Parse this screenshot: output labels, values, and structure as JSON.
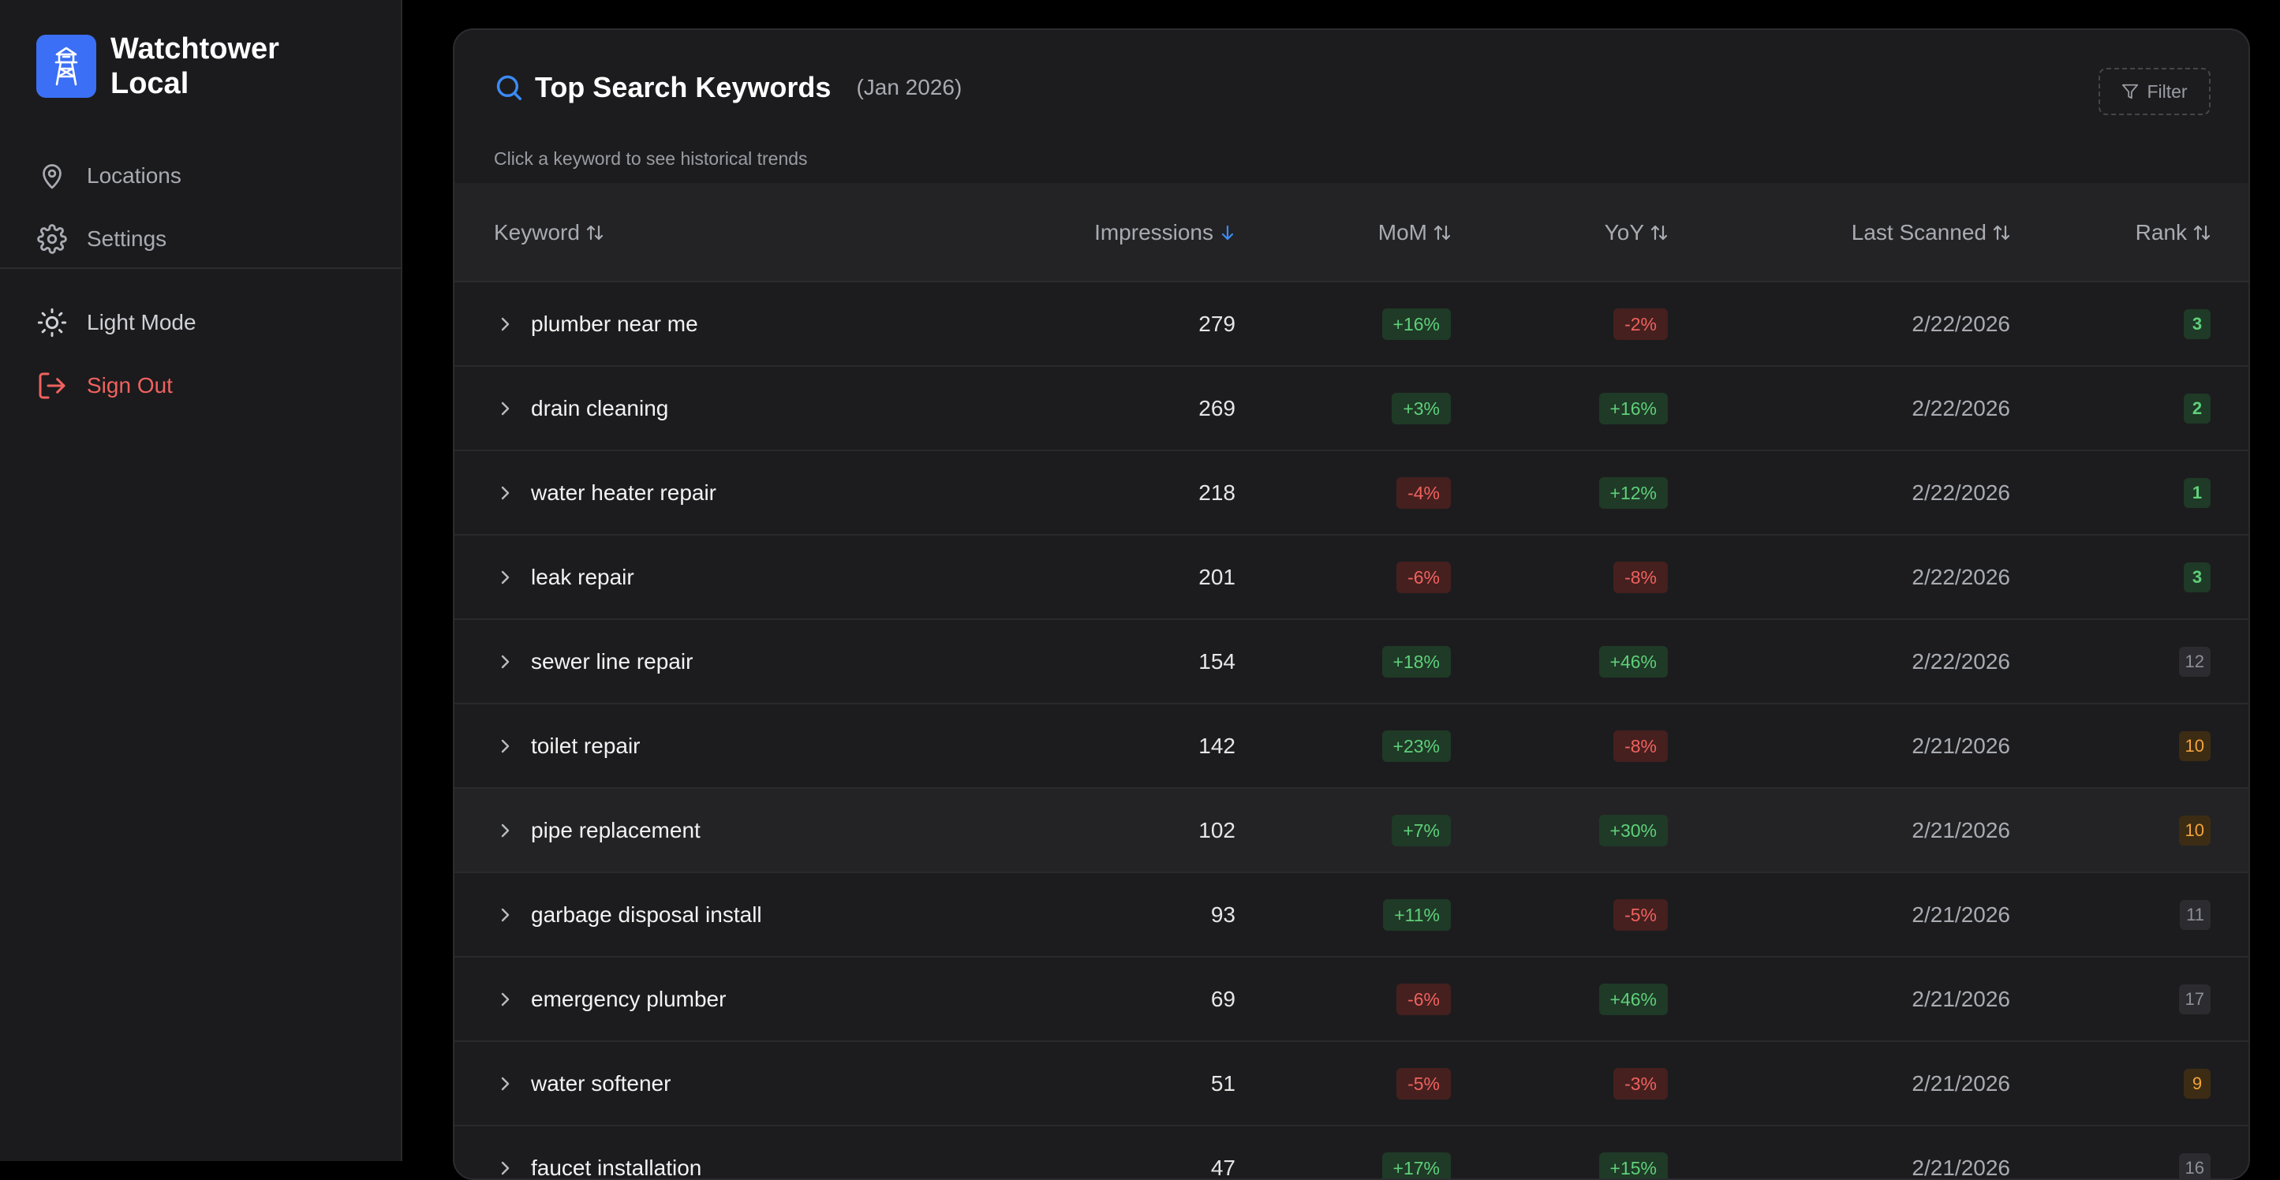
{
  "brand": {
    "name": "Watchtower Local",
    "logo_icon": "watchtower-icon",
    "accent": "#3b6ff5"
  },
  "sidebar": {
    "items": [
      {
        "label": "Locations",
        "icon": "map-pin-icon"
      },
      {
        "label": "Settings",
        "icon": "gear-icon"
      },
      {
        "label": "Light Mode",
        "icon": "sun-icon"
      },
      {
        "label": "Sign Out",
        "icon": "sign-out-icon",
        "color": "#f0625e"
      }
    ]
  },
  "card": {
    "title": "Top Search Keywords",
    "period": "(Jan 2026)",
    "subtitle": "Click a keyword to see historical trends",
    "filter_label": "Filter"
  },
  "table": {
    "columns": [
      {
        "label": "Keyword",
        "sort": "none"
      },
      {
        "label": "Impressions",
        "sort": "desc"
      },
      {
        "label": "MoM",
        "sort": "none"
      },
      {
        "label": "YoY",
        "sort": "none"
      },
      {
        "label": "Last Scanned",
        "sort": "none"
      },
      {
        "label": "Rank",
        "sort": "none"
      }
    ],
    "rows": [
      {
        "keyword": "plumber near me",
        "impressions": "279",
        "mom": "+16%",
        "yoy": "-2%",
        "scanned": "2/22/2026",
        "rank": "3"
      },
      {
        "keyword": "drain cleaning",
        "impressions": "269",
        "mom": "+3%",
        "yoy": "+16%",
        "scanned": "2/22/2026",
        "rank": "2"
      },
      {
        "keyword": "water heater repair",
        "impressions": "218",
        "mom": "-4%",
        "yoy": "+12%",
        "scanned": "2/22/2026",
        "rank": "1"
      },
      {
        "keyword": "leak repair",
        "impressions": "201",
        "mom": "-6%",
        "yoy": "-8%",
        "scanned": "2/22/2026",
        "rank": "3"
      },
      {
        "keyword": "sewer line repair",
        "impressions": "154",
        "mom": "+18%",
        "yoy": "+46%",
        "scanned": "2/22/2026",
        "rank": "12"
      },
      {
        "keyword": "toilet repair",
        "impressions": "142",
        "mom": "+23%",
        "yoy": "-8%",
        "scanned": "2/21/2026",
        "rank": "10"
      },
      {
        "keyword": "pipe replacement",
        "impressions": "102",
        "mom": "+7%",
        "yoy": "+30%",
        "scanned": "2/21/2026",
        "rank": "10"
      },
      {
        "keyword": "garbage disposal install",
        "impressions": "93",
        "mom": "+11%",
        "yoy": "-5%",
        "scanned": "2/21/2026",
        "rank": "11"
      },
      {
        "keyword": "emergency plumber",
        "impressions": "69",
        "mom": "-6%",
        "yoy": "+46%",
        "scanned": "2/21/2026",
        "rank": "17"
      },
      {
        "keyword": "water softener",
        "impressions": "51",
        "mom": "-5%",
        "yoy": "-3%",
        "scanned": "2/21/2026",
        "rank": "9"
      },
      {
        "keyword": "faucet installation",
        "impressions": "47",
        "mom": "+17%",
        "yoy": "+15%",
        "scanned": "2/21/2026",
        "rank": "16"
      }
    ]
  },
  "colors": {
    "positive": "#5fd07a",
    "negative": "#f0625e",
    "rank_amber": "#f3a43b",
    "rank_gray": "#8e9097"
  }
}
